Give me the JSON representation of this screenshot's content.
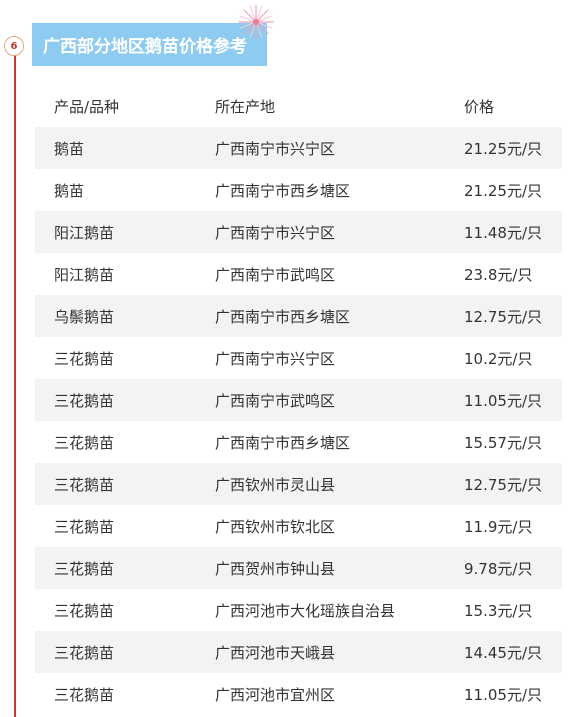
{
  "section": {
    "step_number": "6",
    "title": "广西部分地区鹅苗价格参考"
  },
  "table": {
    "headers": [
      "产品/品种",
      "所在产地",
      "价格"
    ],
    "rows": [
      [
        "鹅苗",
        "广西南宁市兴宁区",
        "21.25元/只"
      ],
      [
        "鹅苗",
        "广西南宁市西乡塘区",
        "21.25元/只"
      ],
      [
        "阳江鹅苗",
        "广西南宁市兴宁区",
        "11.48元/只"
      ],
      [
        "阳江鹅苗",
        "广西南宁市武鸣区",
        "23.8元/只"
      ],
      [
        "乌鬃鹅苗",
        "广西南宁市西乡塘区",
        "12.75元/只"
      ],
      [
        "三花鹅苗",
        "广西南宁市兴宁区",
        "10.2元/只"
      ],
      [
        "三花鹅苗",
        "广西南宁市武鸣区",
        "11.05元/只"
      ],
      [
        "三花鹅苗",
        "广西南宁市西乡塘区",
        "15.57元/只"
      ],
      [
        "三花鹅苗",
        "广西钦州市灵山县",
        "12.75元/只"
      ],
      [
        "三花鹅苗",
        "广西钦州市钦北区",
        "11.9元/只"
      ],
      [
        "三花鹅苗",
        "广西贺州市钟山县",
        "9.78元/只"
      ],
      [
        "三花鹅苗",
        "广西河池市大化瑶族自治县",
        "15.3元/只"
      ],
      [
        "三花鹅苗",
        "广西河池市天峨县",
        "14.45元/只"
      ],
      [
        "三花鹅苗",
        "广西河池市宜州区",
        "11.05元/只"
      ]
    ]
  },
  "colors": {
    "banner": "#8ecbf1",
    "accent_line": "#c0392b",
    "row_shade": "#f3f3f3"
  },
  "icons": {
    "decoration": "firework-icon"
  }
}
